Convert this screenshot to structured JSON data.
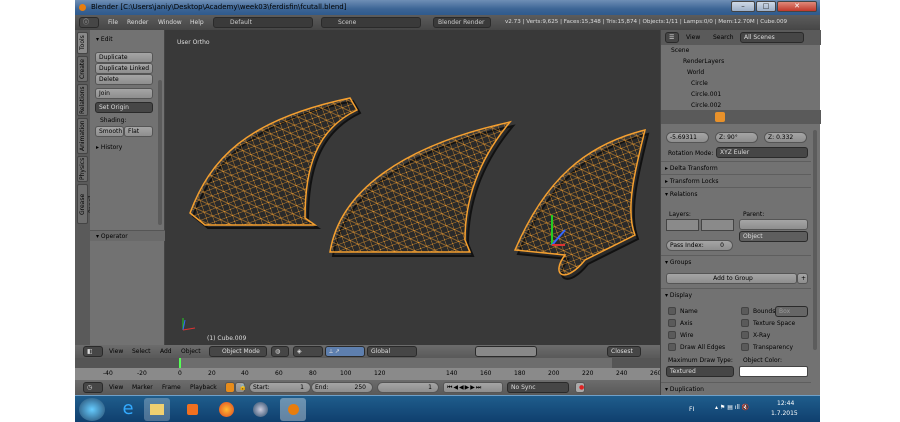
{
  "window": {
    "title": "Blender [C:\\Users\\janiy\\Desktop\\Academy\\week03\\ferdisfin\\fcutall.blend]",
    "min": "–",
    "max": "□",
    "close": "✕"
  },
  "header": {
    "menus": [
      "File",
      "Render",
      "Window",
      "Help"
    ],
    "layout": "Default",
    "scene": "Scene",
    "engine": "Blender Render",
    "stats": "v2.73 | Verts:9,625 | Faces:15,348 | Tris:15,874 | Objects:1/11 | Lamps:0/0 | Mem:12.70M | Cube.009"
  },
  "tabs": [
    "Tools",
    "Create",
    "Relations",
    "Animation",
    "Physics",
    "Grease Pencil"
  ],
  "tools": {
    "edit": "Edit",
    "duplicate": "Duplicate",
    "duplicate_linked": "Duplicate Linked",
    "delete": "Delete",
    "join": "Join",
    "set_origin": "Set Origin",
    "shading": "Shading:",
    "smooth": "Smooth",
    "flat": "Flat",
    "history": "History",
    "operator": "Operator"
  },
  "viewport": {
    "view_name": "User Ortho",
    "object_label": "(1) Cube.009"
  },
  "view3d_header": {
    "menus": [
      "View",
      "Select",
      "Add",
      "Object"
    ],
    "mode": "Object Mode",
    "orientation": "Global",
    "shading_mode": "Closest"
  },
  "ruler": [
    "-40",
    "-20",
    "0",
    "20",
    "40",
    "60",
    "80",
    "100",
    "120",
    "140",
    "160",
    "180",
    "200",
    "220",
    "240",
    "260"
  ],
  "timeline": {
    "menus": [
      "View",
      "Marker",
      "Frame",
      "Playback"
    ],
    "start_label": "Start:",
    "start": "1",
    "end_label": "End:",
    "end": "250",
    "current": "1",
    "sync": "No Sync"
  },
  "outliner": {
    "view": "View",
    "search": "Search",
    "filter": "All Scenes",
    "items": [
      "Scene",
      "RenderLayers",
      "World",
      "Circle",
      "Circle.001",
      "Circle.002"
    ]
  },
  "properties": {
    "loc_x": "-5.69311",
    "rot_z_label": "Z:",
    "rot_z": "90°",
    "scale_z_label": "Z:",
    "scale_z": "0.332",
    "rotation_mode_label": "Rotation Mode:",
    "rotation_mode": "XYZ Euler",
    "delta": "Delta Transform",
    "locks": "Transform Locks",
    "relations": "Relations",
    "layers": "Layers:",
    "parent": "Parent:",
    "parent_type": "Object",
    "pass_index_label": "Pass Index:",
    "pass_index": "0",
    "groups": "Groups",
    "add_group": "Add to Group",
    "display": "Display",
    "name": "Name",
    "axis": "Axis",
    "wire": "Wire",
    "draw_all_edges": "Draw All Edges",
    "bounds": "Bounds",
    "bounds_type": "Box",
    "texture_space": "Texture Space",
    "xray": "X-Ray",
    "transparency": "Transparency",
    "max_draw_label": "Maximum Draw Type:",
    "max_draw": "Textured",
    "object_color": "Object Color:",
    "duplication": "Duplication"
  },
  "taskbar": {
    "lang": "FI",
    "time": "12:44",
    "date": "1.7.2015"
  },
  "colors": {
    "accent": "#f5a030",
    "viewport": "#393939",
    "panel": "#727272"
  }
}
